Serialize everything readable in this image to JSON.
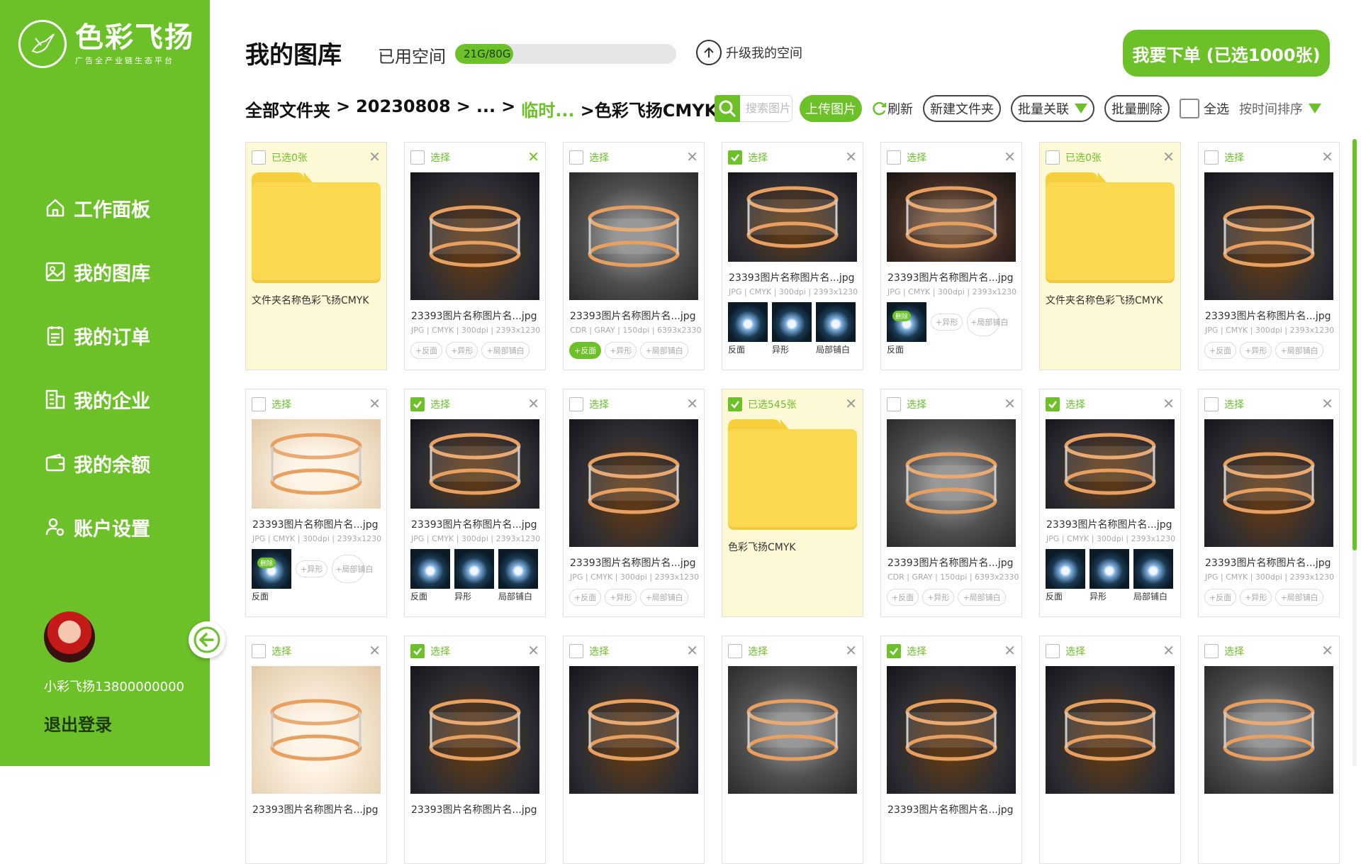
{
  "sidebar": {
    "logo_name": "色彩飞扬",
    "logo_sub": "广告全产业链生态平台",
    "nav": [
      {
        "label": "工作面板",
        "icon": "home-icon"
      },
      {
        "label": "我的图库",
        "icon": "gallery-icon"
      },
      {
        "label": "我的订单",
        "icon": "order-icon"
      },
      {
        "label": "我的企业",
        "icon": "company-icon"
      },
      {
        "label": "我的余额",
        "icon": "wallet-icon"
      },
      {
        "label": "账户设置",
        "icon": "user-settings-icon"
      }
    ],
    "user_name": "小彩飞扬13800000000",
    "logout": "退出登录"
  },
  "header": {
    "title": "我的图库",
    "space_label": "已用空间",
    "space_value": "21G/80G",
    "space_used_fraction": 0.2625,
    "upgrade": "升级我的空间",
    "order_button": "我要下单 (已选1000张)"
  },
  "breadcrumb": {
    "root": "全部文件夹",
    "sep": ">",
    "folder1": "20230808",
    "ellipsis": "...",
    "folder2": "临时...",
    "current": ">色彩飞扬CMYK"
  },
  "toolbar": {
    "search_placeholder": "搜索图片",
    "upload": "上传图片",
    "refresh": "刷新",
    "new_folder": "新建文件夹",
    "batch_link": "批量关联",
    "batch_delete": "批量删除",
    "select_all": "全选",
    "sort": "按时间排序"
  },
  "grid": {
    "rows": [
      [
        {
          "kind": "folder",
          "check": "已选0张",
          "checked": false,
          "name": "文件夹名称色彩飞扬CMYK"
        },
        {
          "kind": "image",
          "check": "选择",
          "checked": false,
          "close_active": true,
          "thumb": "t1",
          "name": "23393图片名称图片名...jpg",
          "meta": "JPG | CMYK | 300dpi | 2393x1230",
          "tags": [
            "+反面",
            "+异形",
            "+局部铺白"
          ],
          "tag_on": -1
        },
        {
          "kind": "image",
          "check": "选择",
          "checked": false,
          "thumb": "t2",
          "name": "23393图片名称图片名...jpg",
          "meta": "CDR | GRAY | 150dpi | 6393x2330",
          "tags": [
            "+反面",
            "+异形",
            "+局部铺白"
          ],
          "tag_on": 0
        },
        {
          "kind": "sub",
          "check": "选择",
          "checked": true,
          "thumb": "t1",
          "name": "23393图片名称图片名...jpg",
          "meta": "JPG | CMYK | 300dpi | 2393x1230",
          "subs": [
            "反面",
            "异形",
            "局部铺白"
          ]
        },
        {
          "kind": "partial",
          "check": "选择",
          "checked": false,
          "thumb": "t4",
          "name": "23393图片名称图片名...jpg",
          "meta": "JPG | CMYK | 300dpi | 2393x1230",
          "sub": "反面",
          "badge": "删除",
          "tags": [
            "+异形",
            "+局部铺白"
          ]
        },
        {
          "kind": "folder",
          "check": "已选0张",
          "checked": false,
          "name": "文件夹名称色彩飞扬CMYK"
        },
        {
          "kind": "image",
          "check": "选择",
          "checked": false,
          "thumb": "t1",
          "name": "23393图片名称图片名...jpg",
          "meta": "JPG | CMYK | 300dpi | 2393x1230",
          "tags": [
            "+反面",
            "+异形",
            "+局部铺白"
          ],
          "tag_on": -1
        }
      ],
      [
        {
          "kind": "partial",
          "check": "选择",
          "checked": false,
          "thumb": "t3",
          "name": "23393图片名称图片名...jpg",
          "meta": "JPG | CMYK | 300dpi | 2393x1230",
          "sub": "反面",
          "badge": "删除",
          "tags": [
            "+异形",
            "+局部铺白"
          ]
        },
        {
          "kind": "sub",
          "check": "选择",
          "checked": true,
          "thumb": "t1",
          "name": "23393图片名称图片名...jpg",
          "meta": "JPG | CMYK | 300dpi | 2393x1230",
          "subs": [
            "反面",
            "异形",
            "局部铺白"
          ]
        },
        {
          "kind": "image",
          "check": "选择",
          "checked": false,
          "thumb": "t1",
          "name": "23393图片名称图片名...jpg",
          "meta": "JPG | CMYK | 300dpi | 2393x1230",
          "tags": [
            "+反面",
            "+异形",
            "+局部铺白"
          ],
          "tag_on": -1
        },
        {
          "kind": "folder",
          "check": "已选545张",
          "checked": true,
          "name": "色彩飞扬CMYK"
        },
        {
          "kind": "image",
          "check": "选择",
          "checked": false,
          "thumb": "t2",
          "name": "23393图片名称图片名...jpg",
          "meta": "CDR | GRAY | 150dpi | 6393x2330",
          "tags": [
            "+反面",
            "+异形",
            "+局部铺白"
          ],
          "tag_on": -1
        },
        {
          "kind": "sub",
          "check": "选择",
          "checked": true,
          "thumb": "t1",
          "name": "23393图片名称图片名...jpg",
          "meta": "JPG | CMYK | 300dpi | 2393x1230",
          "subs": [
            "反面",
            "异形",
            "局部铺白"
          ]
        },
        {
          "kind": "image",
          "check": "选择",
          "checked": false,
          "thumb": "t1",
          "name": "23393图片名称图片名...jpg",
          "meta": "JPG | CMYK | 300dpi | 2393x1230",
          "tags": [
            "+反面",
            "+异形",
            "+局部铺白"
          ],
          "tag_on": -1
        }
      ],
      [
        {
          "kind": "image",
          "check": "选择",
          "checked": false,
          "thumb": "t3",
          "name": "23393图片名称图片名...jpg",
          "meta": "",
          "tags": [],
          "tag_on": -1
        },
        {
          "kind": "image",
          "check": "选择",
          "checked": true,
          "thumb": "t1",
          "name": "23393图片名称图片名...jpg",
          "meta": "",
          "tags": [],
          "tag_on": -1
        },
        {
          "kind": "image",
          "check": "选择",
          "checked": false,
          "thumb": "t1",
          "name": "",
          "meta": "",
          "tags": [],
          "tag_on": -1
        },
        {
          "kind": "image",
          "check": "选择",
          "checked": false,
          "thumb": "t2",
          "name": "",
          "meta": "",
          "tags": [],
          "tag_on": -1
        },
        {
          "kind": "image",
          "check": "选择",
          "checked": true,
          "thumb": "t1",
          "name": "23393图片名称图片名...jpg",
          "meta": "",
          "tags": [],
          "tag_on": -1
        },
        {
          "kind": "image",
          "check": "选择",
          "checked": false,
          "thumb": "t1",
          "name": "",
          "meta": "",
          "tags": [],
          "tag_on": -1
        },
        {
          "kind": "image",
          "check": "选择",
          "checked": false,
          "thumb": "t2",
          "name": "",
          "meta": "",
          "tags": [],
          "tag_on": -1
        }
      ]
    ]
  },
  "colors": {
    "brand": "#6cc128",
    "folder": "#fad84f",
    "folder_card": "#fdf9d6"
  }
}
